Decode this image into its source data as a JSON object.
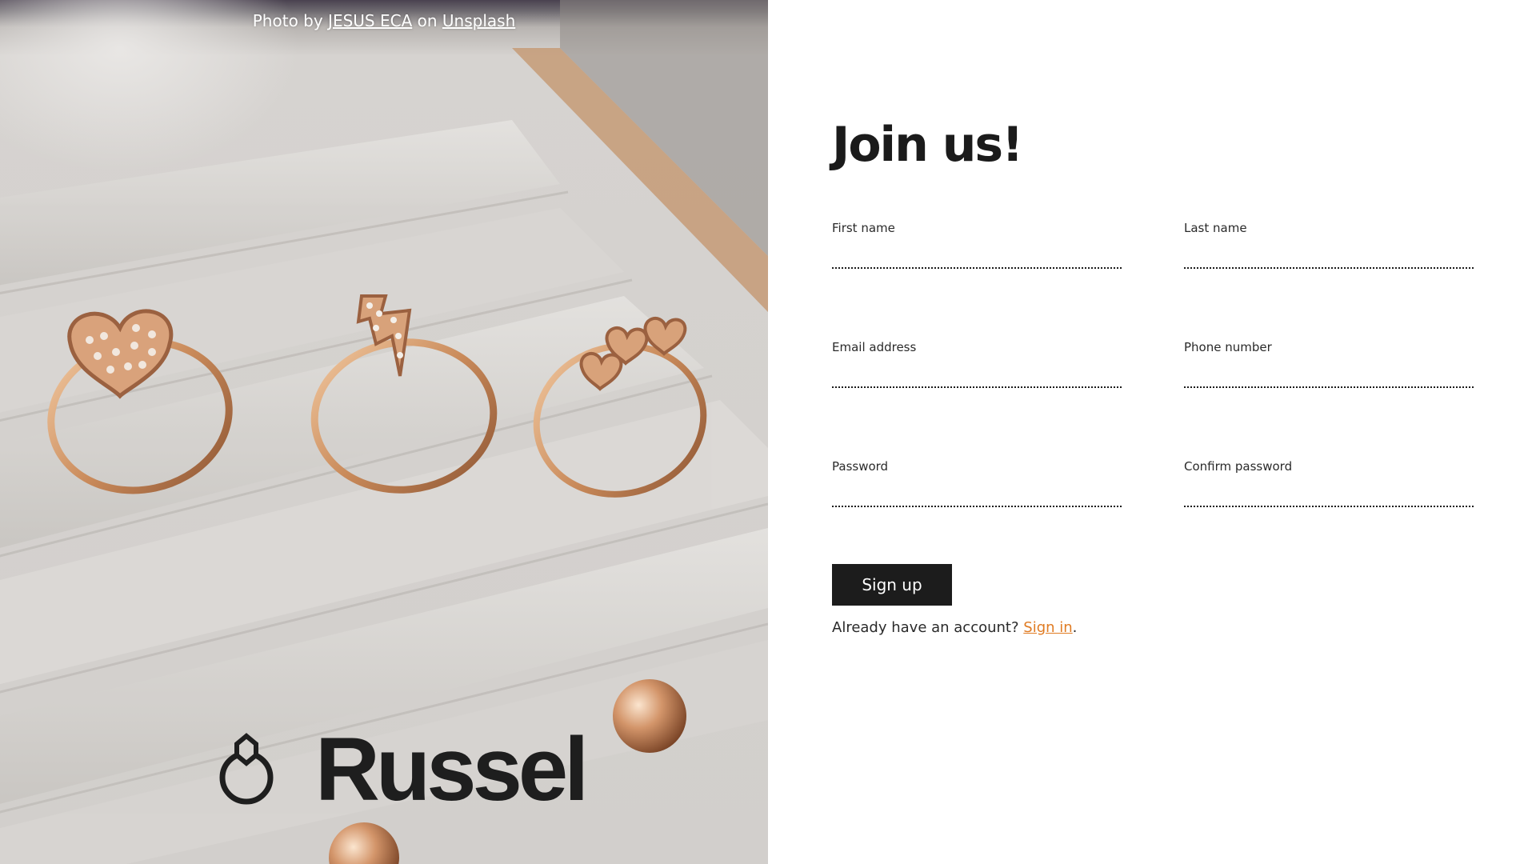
{
  "credit": {
    "prefix": "Photo by ",
    "author": "JESUS ECA",
    "middle": " on ",
    "site": "Unsplash"
  },
  "brand": {
    "name": "Russel",
    "logo_icon": "ring-drop-icon"
  },
  "form": {
    "title": "Join us!",
    "fields": [
      {
        "label": "First name",
        "value": ""
      },
      {
        "label": "Last name",
        "value": ""
      },
      {
        "label": "Email address",
        "value": ""
      },
      {
        "label": "Phone number",
        "value": ""
      },
      {
        "label": "Password",
        "value": ""
      },
      {
        "label": "Confirm password",
        "value": ""
      }
    ],
    "submit_label": "Sign up",
    "signin_prompt": "Already have an account? ",
    "signin_link": "Sign in",
    "signin_suffix": "."
  },
  "colors": {
    "accent": "#e07b22",
    "button": "#1c1c1c",
    "text": "#1c1c1c",
    "background": "#ffffff"
  }
}
